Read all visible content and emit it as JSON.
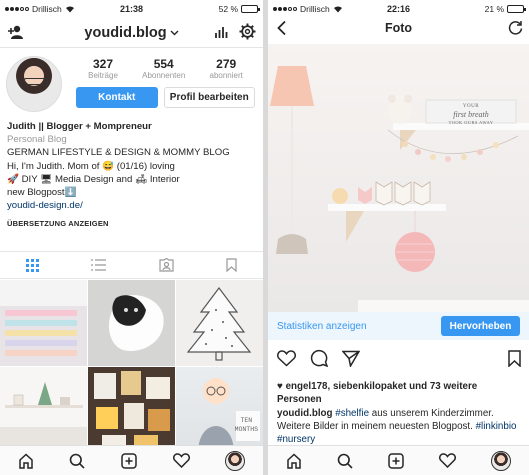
{
  "left": {
    "status": {
      "carrier": "Drillisch",
      "time": "21:38",
      "battery": "52 %",
      "battery_level": 0.52
    },
    "header": {
      "username": "youdid.blog",
      "chevron": "chevron-down-icon"
    },
    "counts": [
      {
        "value": "327",
        "label": "Beiträge"
      },
      {
        "value": "554",
        "label": "Abonnenten"
      },
      {
        "value": "279",
        "label": "abonniert"
      }
    ],
    "buttons": {
      "contact": "Kontakt",
      "edit_profile": "Profil bearbeiten"
    },
    "bio": {
      "name": "Judith || Blogger + Mompreneur",
      "category": "Personal Blog",
      "line1": "GERMAN LIFESTYLE & DESIGN & MOMMY BLOG",
      "line2a": "Hi, I'm Judith. Mom of",
      "line2b": "(01/16) loving",
      "line3a": "DIY",
      "line3b": "Media Design and",
      "line3c": "Interior",
      "line4": "new Blogpost",
      "link": "youdid-design.de/",
      "translate": "ÜBERSETZUNG ANZEIGEN"
    },
    "tabs": [
      "grid-icon",
      "list-icon",
      "tagged-icon",
      "bookmark-icon"
    ],
    "grid_overlay": {
      "ten": "TEN",
      "months": "MONTHS"
    },
    "nav": [
      "home-icon",
      "search-icon",
      "add-icon",
      "heart-icon",
      "profile-avatar"
    ]
  },
  "right": {
    "status": {
      "carrier": "Drillisch",
      "time": "22:16",
      "battery": "21 %",
      "battery_level": 0.21
    },
    "header": {
      "title": "Foto"
    },
    "photo_text": {
      "line1": "YOUR",
      "line2": "first breath",
      "line3": "TOOK OURS AWAY"
    },
    "ad_bar": {
      "stats_link": "Statistiken anzeigen",
      "promote": "Hervorheben"
    },
    "likes": "engel178, siebenkilopaket und 73 weitere Personen",
    "caption": {
      "user": "youdid.blog",
      "tag1": "#shelfie",
      "text1": "aus unserem Kinderzimmer. Weitere Bilder in meinem neuesten Blogpost.",
      "tag2": "#linkinbio",
      "tag3": "#nursery"
    },
    "nav": [
      "home-icon",
      "search-icon",
      "add-icon",
      "heart-icon",
      "profile-avatar"
    ]
  },
  "colors": {
    "accent": "#3897f0",
    "link": "#003569",
    "muted": "#999999"
  }
}
